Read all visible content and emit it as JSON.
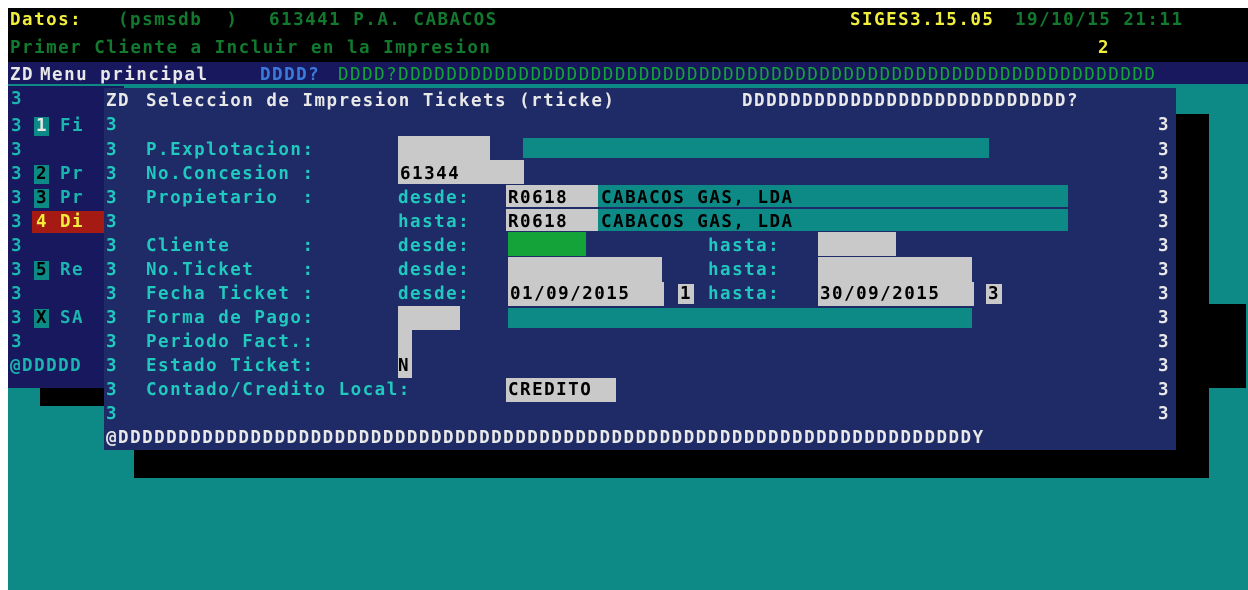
{
  "status_bar": {
    "label": "Datos:",
    "db": "(psmsdb  )",
    "code": "613441 P.A. CABACOS",
    "version": "SIGES3.15.05",
    "datetime": "19/10/15 21:11"
  },
  "prompt": {
    "text": "Primer Cliente a Incluir en la Impresion",
    "count": "2"
  },
  "menu_bar": {
    "prefix": "ZD",
    "title": "Menu principal",
    "border": "DDDD?DDDDDDDDDDDDDDDDDDDDDDDDDDDDDDDDDDDDDDDDDDDDDDDDDDDDDDDDDDDDDDD"
  },
  "menu": {
    "left_border": [
      "3",
      "3",
      "3",
      "3",
      "3",
      "3",
      "3",
      "3",
      "3",
      "3",
      "3"
    ],
    "items": [
      {
        "key": "1",
        "label": "Fi"
      },
      {
        "key": "2",
        "label": "Pr"
      },
      {
        "key": "3",
        "label": "Pr"
      },
      {
        "key": "4",
        "label": "Di"
      },
      {
        "key": "5",
        "label": "Re"
      },
      {
        "key": "X",
        "label": "SA"
      }
    ],
    "bottom_border": "@DDDDD"
  },
  "dialog": {
    "title_prefix": "ZD",
    "title": "Seleccion de Impresion Tickets (rticke)",
    "title_border": "DDDDDDDDDDDDDDDDDDDDDDDDDDD?",
    "side_char": "3",
    "bottom_border": "@DDDDDDDDDDDDDDDDDDDDDDDDDDDDDDDDDDDDDDDDDDDDDDDDDDDDDDDDDDDDDDDDDDDDDDDY",
    "labels": {
      "explotacion": "P.Explotacion:",
      "concesion": "No.Concesion :",
      "propietario": "Propietario  :",
      "cliente": "Cliente      :",
      "ticket": "No.Ticket    :",
      "fecha": "Fecha Ticket :",
      "forma_pago": "Forma de Pago:",
      "periodo": "Periodo Fact.:",
      "estado": "Estado Ticket:",
      "contado": "Contado/Credito Local:",
      "desde": "desde:",
      "hasta": "hasta:"
    },
    "values": {
      "concesion": "61344",
      "prop_desde_code": "R0618",
      "prop_desde_name": "CABACOS GAS, LDA",
      "prop_hasta_code": "R0618",
      "prop_hasta_name": "CABACOS GAS, LDA",
      "fecha_desde": "01/09/2015",
      "fecha_desde_flag": "1",
      "fecha_hasta": "30/09/2015",
      "fecha_hasta_flag": "3",
      "estado": "N",
      "contado": "CREDITO"
    }
  }
}
